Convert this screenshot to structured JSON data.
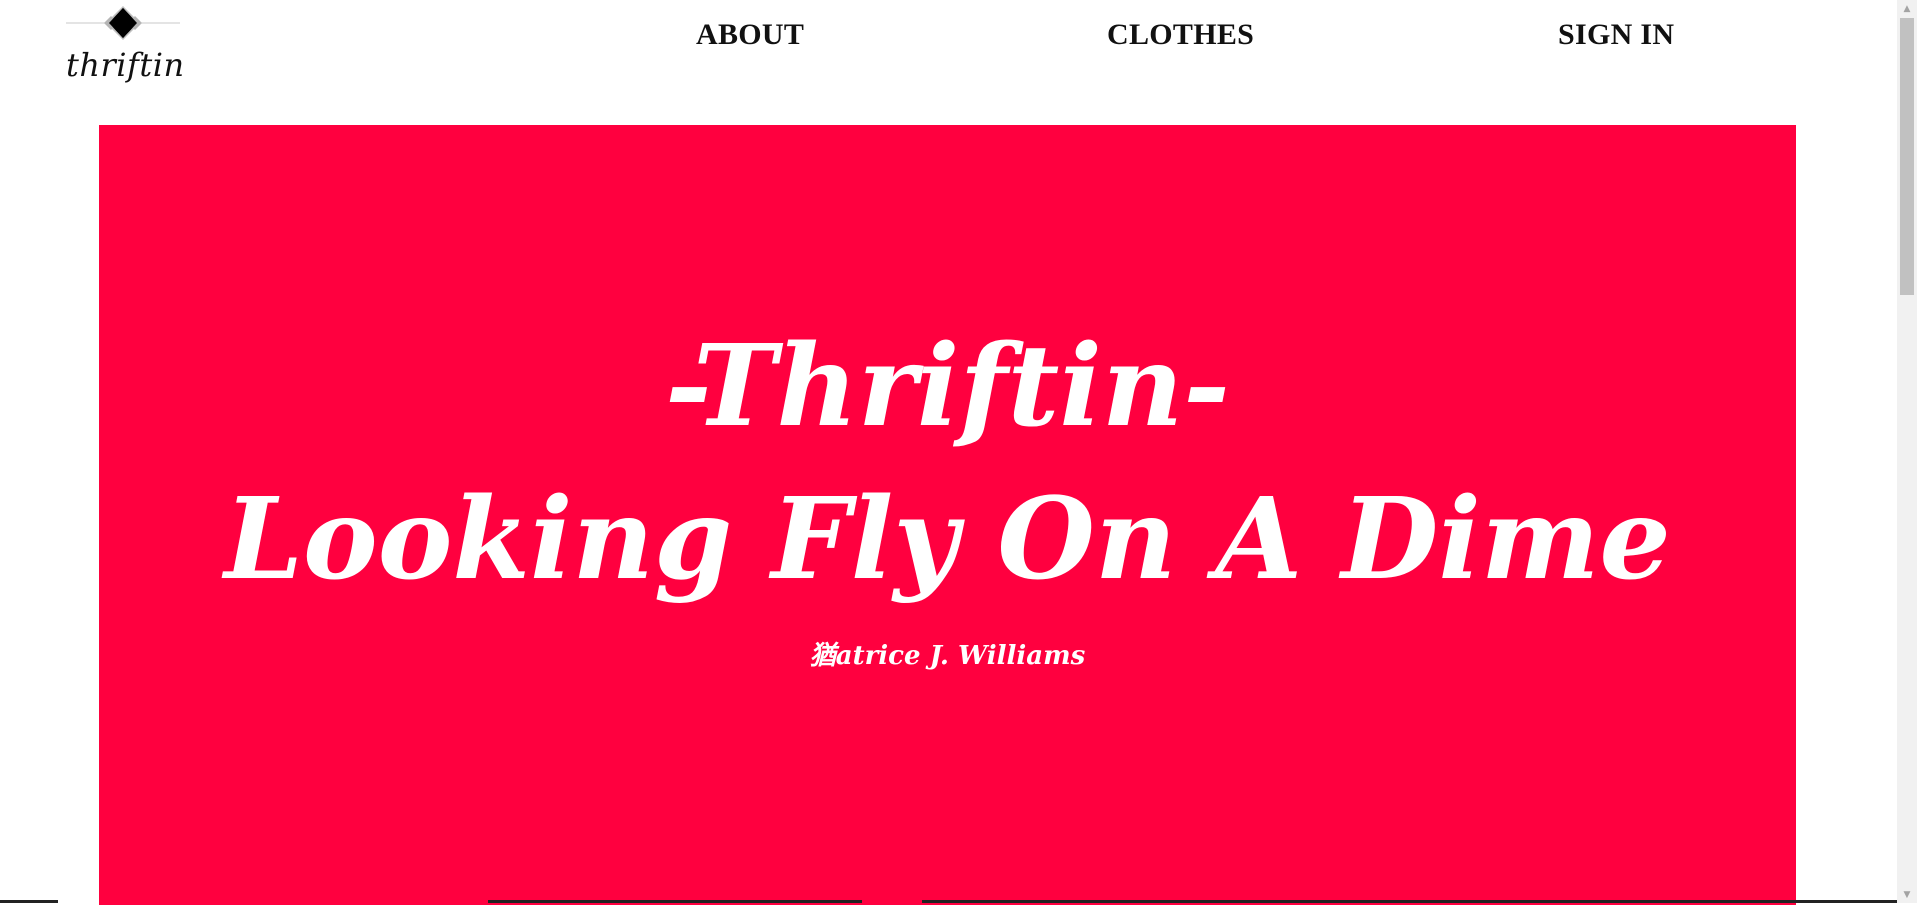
{
  "header": {
    "logo_text": "thriftin",
    "nav": {
      "about": "ABOUT",
      "clothes": "CLOTHES",
      "sign_in": "SIGN IN"
    }
  },
  "hero": {
    "line1": "-Thriftin-",
    "line2": "Looking Fly On A Dime",
    "credit": "猶atrice J. Williams",
    "background_color": "#ff003f",
    "text_color": "#ffffff"
  },
  "scrollbar": {
    "up_icon": "scroll-up-arrow",
    "down_icon": "scroll-down-arrow"
  }
}
